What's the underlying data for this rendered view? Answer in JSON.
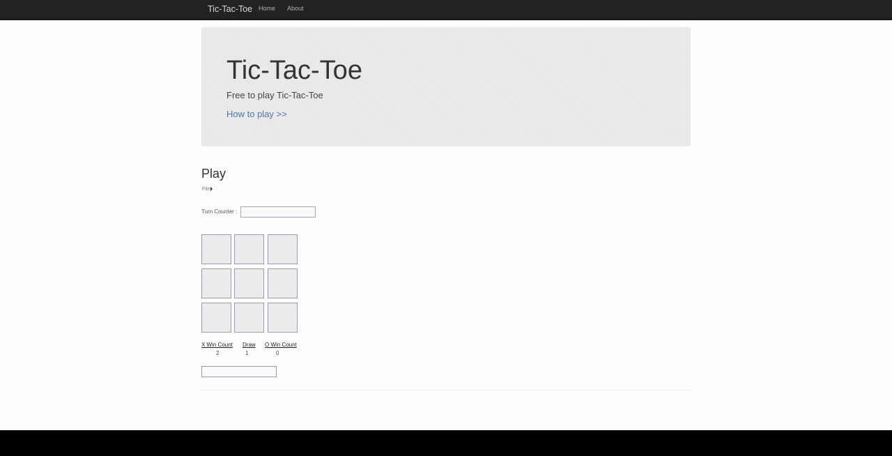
{
  "navbar": {
    "brand": "Tic-Tac-Toe",
    "links": [
      "Home",
      "About"
    ]
  },
  "hero": {
    "title": "Tic-Tac-Toe",
    "subtitle": "Free to play Tic-Tac-Toe",
    "link": "How to play >>"
  },
  "play": {
    "title": "Play",
    "file_menu": "File",
    "turn_counter_label": "Turn Counter :",
    "turn_counter_value": "",
    "board": [
      "",
      "",
      "",
      "",
      "",
      "",
      "",
      "",
      ""
    ],
    "stats": {
      "x_label": "X Win Count",
      "x_value": "2",
      "draw_label": "Draw",
      "draw_value": "1",
      "o_label": "O Win Count",
      "o_value": "0"
    },
    "message": ""
  }
}
